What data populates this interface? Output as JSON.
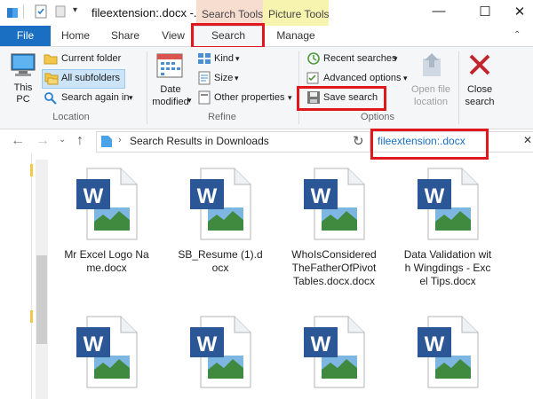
{
  "window": {
    "title": "fileextension:.docx -...",
    "context_tabs": [
      "Search Tools",
      "Picture Tools"
    ]
  },
  "tabs": [
    "File",
    "Home",
    "Share",
    "View",
    "Search",
    "Manage"
  ],
  "ribbon": {
    "location": {
      "this_pc": "This PC",
      "current_folder": "Current folder",
      "all_subfolders": "All subfolders",
      "search_again_in": "Search again in",
      "group_label": "Location"
    },
    "refine": {
      "date_modified": "Date modified",
      "kind": "Kind",
      "size": "Size",
      "other_properties": "Other properties",
      "group_label": "Refine"
    },
    "options": {
      "recent_searches": "Recent searches",
      "advanced_options": "Advanced options",
      "save_search": "Save search",
      "open_file_location": "Open file location",
      "group_label": "Options"
    },
    "close_search": "Close search"
  },
  "address": {
    "path": "Search Results in Downloads",
    "search_query": "fileextension:.docx"
  },
  "files": [
    {
      "name": "Mr Excel Logo Name.docx"
    },
    {
      "name": "SB_Resume (1).docx"
    },
    {
      "name": "WhoIsConsideredTheFatherOfPivotTables.docx.docx"
    },
    {
      "name": "Data Validation with Wingdings - Excel Tips.docx"
    },
    {
      "name": ""
    },
    {
      "name": ""
    },
    {
      "name": ""
    },
    {
      "name": ""
    }
  ],
  "colors": {
    "file_tab": "#1a6fc2",
    "search_tools": "#f7dcd0",
    "picture_tools": "#f7f4b0",
    "highlight": "#e0181d",
    "query_text": "#1a6fc2"
  }
}
